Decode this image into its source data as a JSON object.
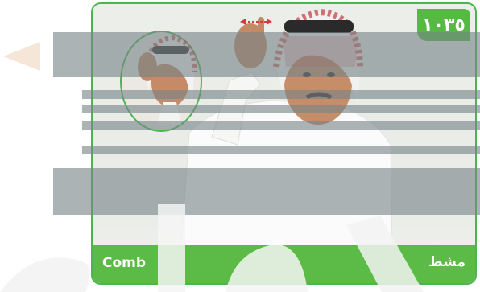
{
  "badge": {
    "number": "١٠٣٥"
  },
  "footer": {
    "english_label": "Comb",
    "arabic_label": "مشط"
  },
  "illustration": {
    "subject": "man-in-shemagh-signing",
    "inset": "closeup-circle"
  },
  "colors": {
    "accent_green": "#55b943",
    "card_border": "#4bb54f",
    "overlay_gray": "#7a868a",
    "shemagh_red": "#c7373b"
  }
}
